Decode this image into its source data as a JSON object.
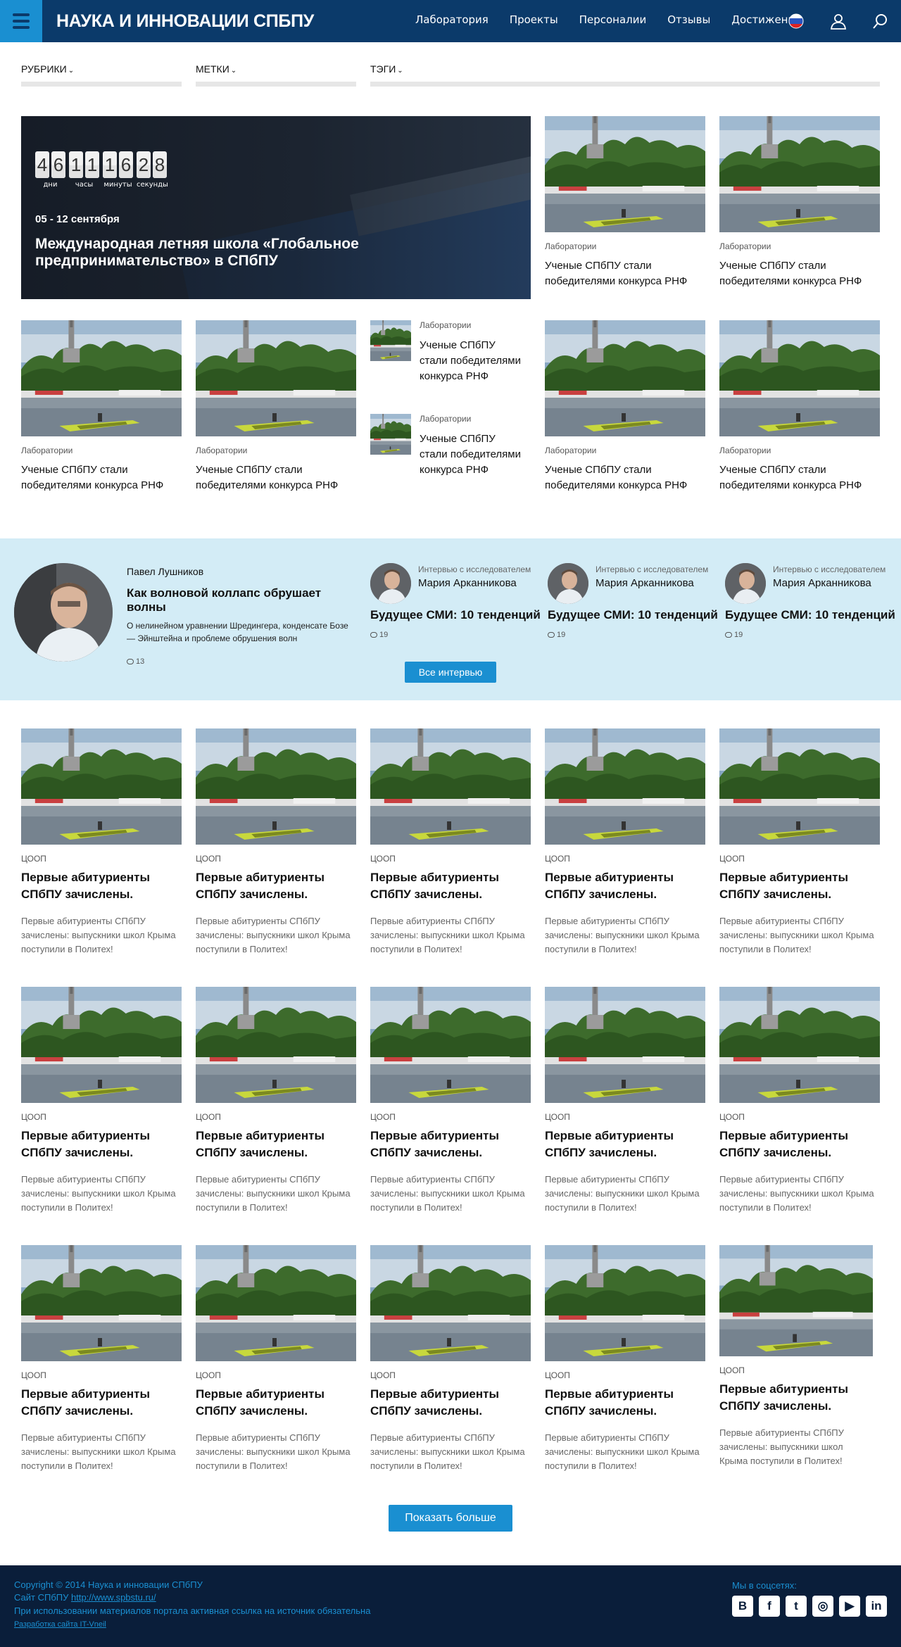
{
  "header": {
    "title": "НАУКА И ИННОВАЦИИ СПБПУ",
    "nav": [
      "Лаборатория",
      "Проекты",
      "Персоналии",
      "Отзывы",
      "Достижения"
    ],
    "colors": {
      "bar": "#0b3a6a",
      "accent": "#1a8fd1"
    }
  },
  "filters": {
    "rubrics": "РУБРИКИ",
    "marks": "МЕТКИ",
    "tags": "ТЭГИ"
  },
  "hero": {
    "countdown": {
      "days": "46",
      "hours": "11",
      "minutes": "16",
      "seconds": "28",
      "days_label": "дни",
      "hours_label": "часы",
      "minutes_label": "минуты",
      "seconds_label": "секунды"
    },
    "date": "05 - 12 сентября",
    "title": "Международная летняя школа «Глобальное предпринимательство» в СПбПУ"
  },
  "lab_card": {
    "category": "Лаборатории",
    "title": "Ученые СПбПУ стали победителями конкурса РНФ"
  },
  "interviews": {
    "featured": {
      "name": "Павел Лушников",
      "title": "Как волновой коллапс обрушает волны",
      "summary": "О нелинейном уравнении Шредингера, конденсате Бозе — Эйнштейна и проблеме обрушения волн",
      "comments": "13"
    },
    "items": [
      {
        "type": "Интервью с исследователем",
        "name": "Мария Арканникова",
        "title": "Будущее СМИ: 10 тенденций",
        "comments": "19"
      },
      {
        "type": "Интервью с исследователем",
        "name": "Мария Арканникова",
        "title": "Будущее СМИ: 10 тенденций",
        "comments": "19"
      },
      {
        "type": "Интервью с исследователем",
        "name": "Мария Арканникова",
        "title": "Будущее СМИ: 10 тенденций",
        "comments": "19"
      }
    ],
    "all_button": "Все интервью",
    "background": "#d3ecf6"
  },
  "news_card": {
    "category": "ЦООП",
    "title": "Первые абитуриенты СПбПУ зачислены.",
    "summary": "Первые абитуриенты СПбПУ зачислены: выпускники школ Крыма поступили в Политех!"
  },
  "show_more": "Показать больше",
  "footer": {
    "copyright": "Copyright © 2014 Наука и инновации СПбПУ",
    "site_prefix": "Сайт СПбПУ ",
    "site_link": "http://www.spbstu.ru/",
    "notice": "При использовании материалов портала активная ссылка на источник обязательна",
    "developer": "Разработка сайта IT-Vneil",
    "social_label": "Мы в соцсетях:",
    "social": [
      {
        "icon": "vk-icon",
        "glyph": "В"
      },
      {
        "icon": "facebook-icon",
        "glyph": "f"
      },
      {
        "icon": "twitter-icon",
        "glyph": "t"
      },
      {
        "icon": "instagram-icon",
        "glyph": "◎"
      },
      {
        "icon": "youtube-icon",
        "glyph": "▶"
      },
      {
        "icon": "linkedin-icon",
        "glyph": "in"
      }
    ]
  }
}
